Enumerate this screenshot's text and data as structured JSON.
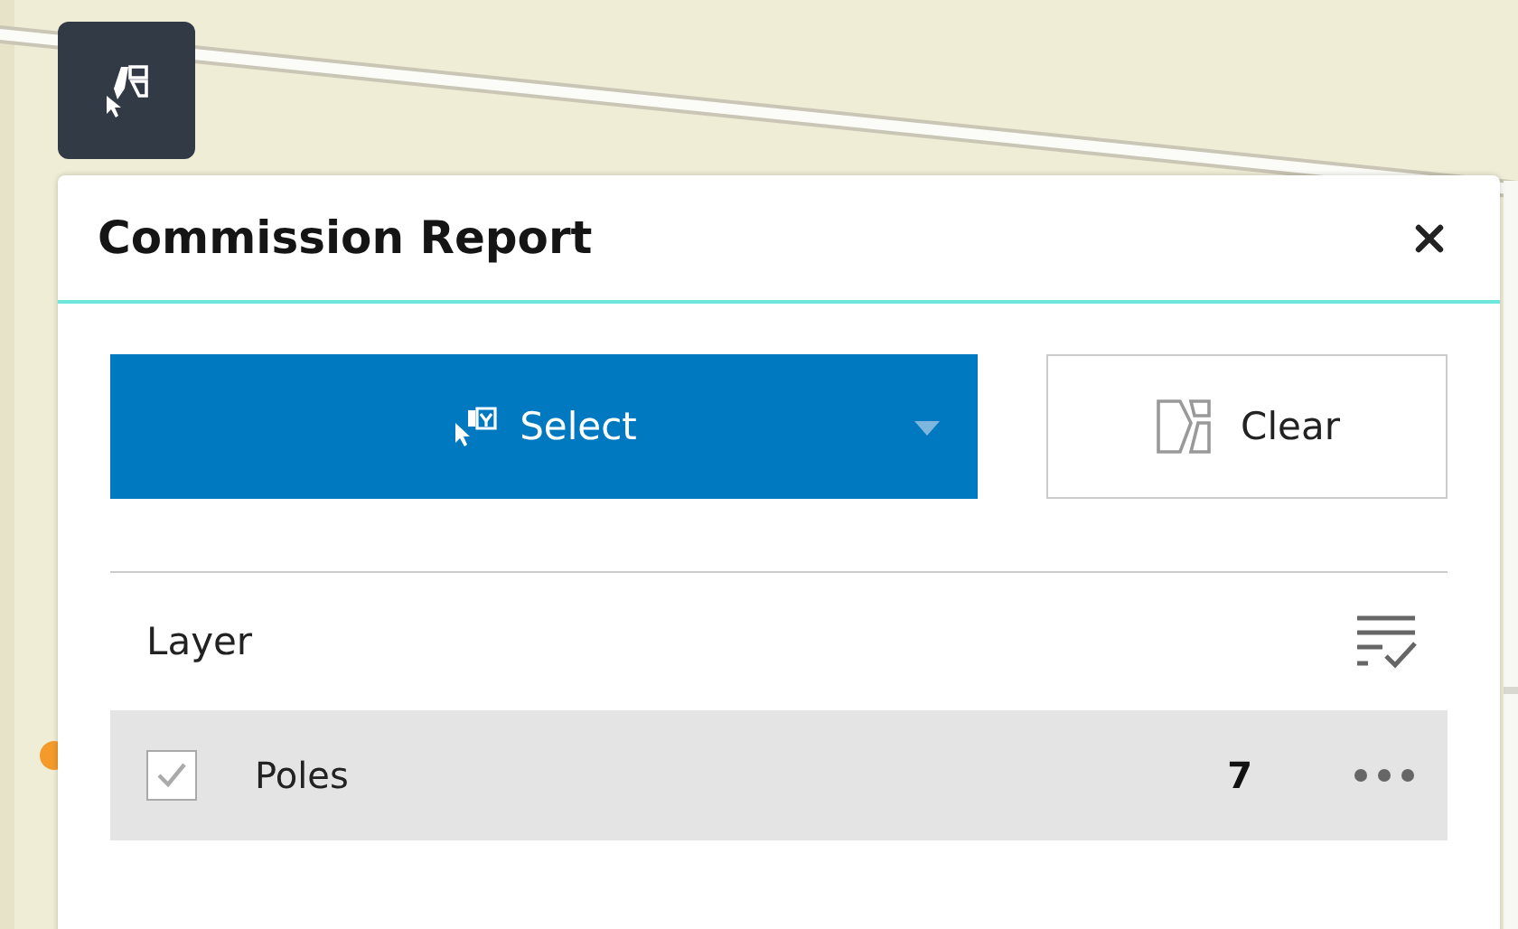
{
  "panel": {
    "title": "Commission Report"
  },
  "select_button": {
    "label": "Select"
  },
  "clear_button": {
    "label": "Clear"
  },
  "layer_list": {
    "header": "Layer",
    "layers": [
      {
        "name": "Poles",
        "count": "7",
        "checked": true
      }
    ]
  }
}
